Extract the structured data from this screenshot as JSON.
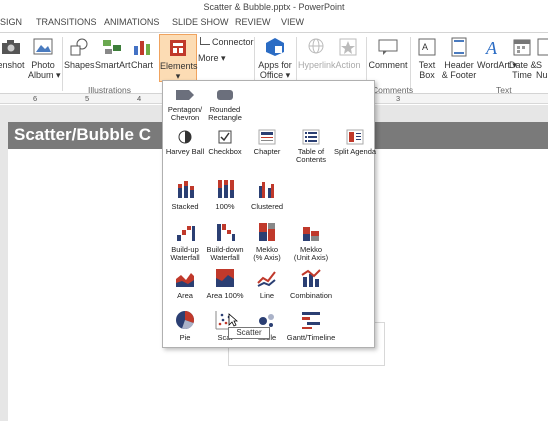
{
  "window": {
    "title": "Scatter & Bubble.pptx - PowerPoint"
  },
  "tabs": [
    "SIGN",
    "TRANSITIONS",
    "ANIMATIONS",
    "SLIDE SHOW",
    "REVIEW",
    "VIEW"
  ],
  "ribbon": {
    "items": {
      "screenshot": "enshot",
      "photo_album_1": "Photo",
      "photo_album_2": "Album",
      "shapes": "Shapes",
      "smartart": "SmartArt",
      "chart": "Chart",
      "elements": "Elements",
      "connector": "Connector",
      "more": "More",
      "apps_1": "Apps for",
      "apps_2": "Office",
      "hyperlink": "Hyperlink",
      "action": "Action",
      "comment": "Comment",
      "textbox_1": "Text",
      "textbox_2": "Box",
      "header_1": "Header",
      "header_2": "& Footer",
      "wordart": "WordArt",
      "date_1": "Date &",
      "date_2": "Time",
      "slide_num_1": "S",
      "slide_num_2": "Nu"
    },
    "groups": {
      "illustrations": "Illustrations",
      "comments": "Comments",
      "text": "Text"
    }
  },
  "ruler": {
    "marks": [
      "6",
      "5",
      "4",
      "3"
    ]
  },
  "slide": {
    "title": "Scatter/Bubble C"
  },
  "menu": {
    "items": [
      {
        "label1": "Pentagon/",
        "label2": "Chevron"
      },
      {
        "label1": "Rounded",
        "label2": "Rectangle"
      },
      {
        "label1": "Harvey Ball",
        "label2": ""
      },
      {
        "label1": "Checkbox",
        "label2": ""
      },
      {
        "label1": "Chapter",
        "label2": ""
      },
      {
        "label1": "Table of",
        "label2": "Contents"
      },
      {
        "label1": "Split Agenda",
        "label2": ""
      },
      {
        "label1": "Stacked",
        "label2": ""
      },
      {
        "label1": "100%",
        "label2": ""
      },
      {
        "label1": "Clustered",
        "label2": ""
      },
      {
        "label1": "Build-up",
        "label2": "Waterfall"
      },
      {
        "label1": "Build-down",
        "label2": "Waterfall"
      },
      {
        "label1": "Mekko",
        "label2": "(% Axis)"
      },
      {
        "label1": "Mekko",
        "label2": "(Unit Axis)"
      },
      {
        "label1": "Area",
        "label2": ""
      },
      {
        "label1": "Area 100%",
        "label2": ""
      },
      {
        "label1": "Line",
        "label2": ""
      },
      {
        "label1": "Combination",
        "label2": ""
      },
      {
        "label1": "Pie",
        "label2": ""
      },
      {
        "label1": "Scat",
        "label2": ""
      },
      {
        "label1": "ubble",
        "label2": ""
      },
      {
        "label1": "Gantt/Timeline",
        "label2": ""
      }
    ]
  },
  "tooltip": "Scatter",
  "colors": {
    "accent_red": "#c0392b",
    "navy": "#2b3f73",
    "tab_active": "#c55a2b",
    "slide_title_bg": "#7a7a7a"
  }
}
